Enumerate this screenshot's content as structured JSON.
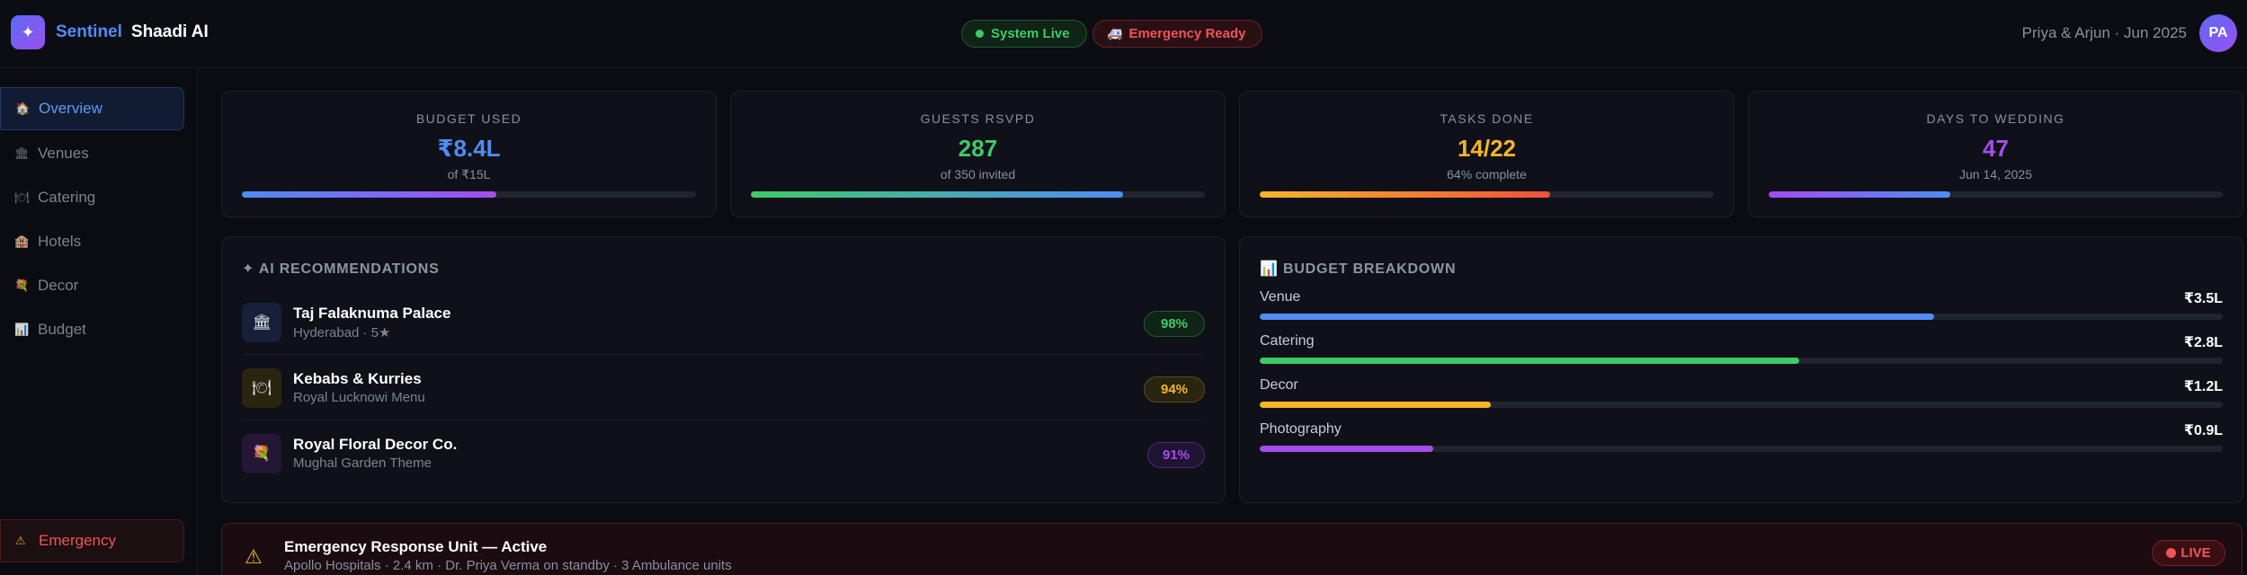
{
  "header": {
    "logo_icon": "sparkle-icon",
    "logo_glyph": "✦",
    "brand_primary": "Sentinel",
    "brand_secondary": "Shaadi AI",
    "system_status": "System Live",
    "emergency_status": "Emergency Ready",
    "emergency_glyph": "🚑",
    "user_info": "Priya & Arjun · Jun 2025",
    "avatar_initials": "PA"
  },
  "sidebar": {
    "items": [
      {
        "label": "Overview",
        "icon": "home-icon",
        "glyph": "🏠"
      },
      {
        "label": "Venues",
        "icon": "venue-icon",
        "glyph": "🏛"
      },
      {
        "label": "Catering",
        "icon": "catering-icon",
        "glyph": "🍽"
      },
      {
        "label": "Hotels",
        "icon": "hotel-icon",
        "glyph": "🏨"
      },
      {
        "label": "Decor",
        "icon": "decor-icon",
        "glyph": "💐"
      },
      {
        "label": "Budget",
        "icon": "budget-icon",
        "glyph": "📊"
      }
    ],
    "emergency": {
      "label": "Emergency",
      "icon": "warning-icon",
      "glyph": "⚠"
    }
  },
  "stats": [
    {
      "label": "BUDGET USED",
      "value": "₹8.4L",
      "sub": "of ₹15L",
      "progress": 0.56,
      "color": "#4f8cf6"
    },
    {
      "label": "GUESTS RSVPD",
      "value": "287",
      "sub": "of 350 invited",
      "progress": 0.82,
      "color": "#3ecb68"
    },
    {
      "label": "TASKS DONE",
      "value": "14/22",
      "sub": "64% complete",
      "progress": 0.64,
      "color": "#f5b52a"
    },
    {
      "label": "DAYS TO WEDDING",
      "value": "47",
      "sub": "Jun 14, 2025",
      "progress": 0.4,
      "color": "#a44cf0"
    }
  ],
  "recommendations": {
    "title": "✦ AI RECOMMENDATIONS",
    "items": [
      {
        "name": "Taj Falaknuma Palace",
        "sub": "Hyderabad · 5★",
        "score": "98%",
        "icon": "palace-icon",
        "glyph": "🏛"
      },
      {
        "name": "Kebabs & Kurries",
        "sub": "Royal Lucknowi Menu",
        "score": "94%",
        "icon": "catering-icon",
        "glyph": "🍽"
      },
      {
        "name": "Royal Floral Decor Co.",
        "sub": "Mughal Garden Theme",
        "score": "91%",
        "icon": "flower-icon",
        "glyph": "💐"
      }
    ]
  },
  "budget": {
    "title": "📊 BUDGET BREAKDOWN",
    "items": [
      {
        "name": "Venue",
        "amount": "₹3.5L",
        "progress": 0.7,
        "color": "#4f8cf6"
      },
      {
        "name": "Catering",
        "amount": "₹2.8L",
        "progress": 0.56,
        "color": "#3ecb68"
      },
      {
        "name": "Decor",
        "amount": "₹1.2L",
        "progress": 0.24,
        "color": "#f5b52a"
      },
      {
        "name": "Photography",
        "amount": "₹0.9L",
        "progress": 0.18,
        "color": "#a44cf0"
      }
    ]
  },
  "emergency_banner": {
    "icon": "warning-icon",
    "glyph": "⚠",
    "title": "Emergency Response Unit — Active",
    "subtitle": "Apollo Hospitals · 2.4 km · Dr. Priya Verma on standby · 3 Ambulance units",
    "badge": "LIVE"
  }
}
